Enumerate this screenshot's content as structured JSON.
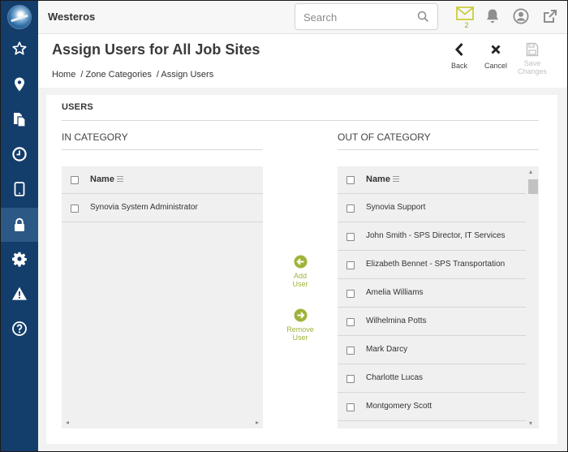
{
  "app": {
    "title": "Westeros"
  },
  "search": {
    "placeholder": "Search"
  },
  "notifications": {
    "mail_count": "2"
  },
  "sidebar": {
    "items": [
      {
        "icon": "star-icon",
        "active": false
      },
      {
        "icon": "location-pin-icon",
        "active": false
      },
      {
        "icon": "documents-icon",
        "active": false
      },
      {
        "icon": "clock-icon",
        "active": false
      },
      {
        "icon": "tablet-icon",
        "active": false
      },
      {
        "icon": "lock-icon",
        "active": true
      },
      {
        "icon": "gear-icon",
        "active": false
      },
      {
        "icon": "warning-icon",
        "active": false
      },
      {
        "icon": "help-icon",
        "active": false
      }
    ]
  },
  "page": {
    "title": "Assign Users for All Job Sites",
    "breadcrumb": [
      "Home",
      "/ Zone Categories",
      "/ Assign Users"
    ]
  },
  "actions": {
    "back": "Back",
    "cancel": "Cancel",
    "save_line1": "Save",
    "save_line2": "Changes"
  },
  "section": {
    "title": "USERS"
  },
  "in_category": {
    "heading": "IN CATEGORY",
    "column": "Name",
    "rows": [
      "Synovia System Administrator"
    ]
  },
  "out_category": {
    "heading": "OUT OF CATEGORY",
    "column": "Name",
    "rows": [
      "Synovia Support",
      "John Smith - SPS Director, IT Services",
      "Elizabeth Bennet - SPS Transportation",
      "Amelia Williams",
      "Wilhelmina Potts",
      "Mark Darcy",
      "Charlotte Lucas",
      "Montgomery Scott"
    ]
  },
  "transfer": {
    "add_line1": "Add",
    "add_line2": "User",
    "remove_line1": "Remove",
    "remove_line2": "User"
  },
  "colors": {
    "sidebar": "#133d6b",
    "sidebar_active": "#2c5886",
    "accent_green": "#a1b23a",
    "mail_icon": "#c4c92c"
  }
}
